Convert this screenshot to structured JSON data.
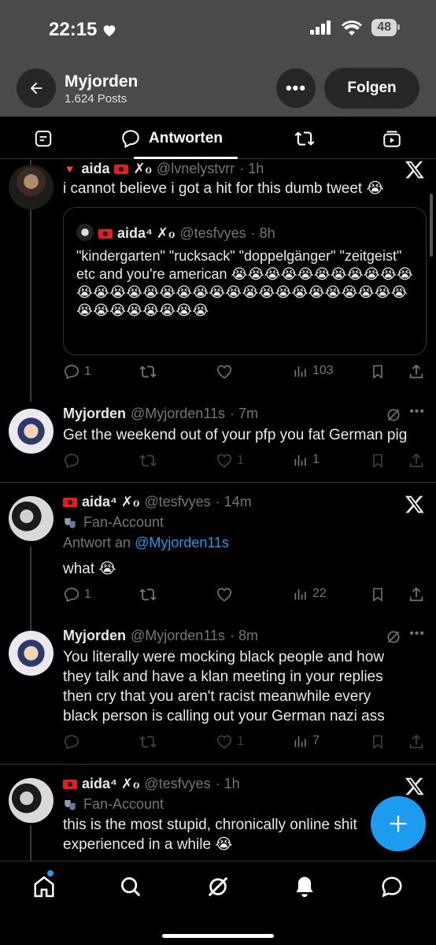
{
  "status_bar": {
    "time": "22:15",
    "battery": "48"
  },
  "header": {
    "profile_name": "Myjorden",
    "posts_count": "1.624 Posts",
    "follow_label": "Folgen",
    "more_label": "•••"
  },
  "tabs": {
    "active_label": "Antworten"
  },
  "tweets": [
    {
      "name": "aida",
      "handle": "@lvnelystvrr",
      "time": "· 1h",
      "text": "i cannot believe i got a hit for this dumb tweet 😭",
      "quote": {
        "name": "aida⁴ ✗ℴ",
        "handle": "@tesfvyes",
        "time": "· 8h",
        "text": "\"kindergarten\" \"rucksack\" \"doppelgänger\" \"zeitgeist\" etc and you're american 😭😭😭😭😭😭😭😭😭😭😭😭😭😭😭😭😭😭😭😭😭😭😭😭😭😭😭😭😭😭😭😭😭😭😭😭😭😭😭"
      },
      "replies": "1",
      "views": "103"
    },
    {
      "name": "Myjorden",
      "handle": "@Myjorden11s",
      "time": "· 7m",
      "text": "Get the weekend out of your pfp you fat German pig",
      "likes": "1",
      "views": "1"
    },
    {
      "name": "aida⁴ ✗ℴ",
      "handle": "@tesfvyes",
      "time": "· 14m",
      "badge": "Fan-Account",
      "reply_to_prefix": "Antwort an",
      "reply_to": "@Myjorden11s",
      "text": "what 😭",
      "replies": "1",
      "views": "22"
    },
    {
      "name": "Myjorden",
      "handle": "@Myjorden11s",
      "time": "· 8m",
      "text": "You literally were mocking black people and how they talk and have a klan meeting in your replies then cry that you aren't racist meanwhile every black person is calling out your German nazi ass",
      "likes": "1",
      "views": "7"
    },
    {
      "name": "aida⁴ ✗ℴ",
      "handle": "@tesfvyes",
      "time": "· 1h",
      "badge": "Fan-Account",
      "text": "this is the most stupid, chronically online shit experienced in a while 😭"
    }
  ],
  "colors": {
    "accent": "#1d9bf0",
    "header_bg": "#4a4a4a",
    "muted": "#71767b"
  }
}
